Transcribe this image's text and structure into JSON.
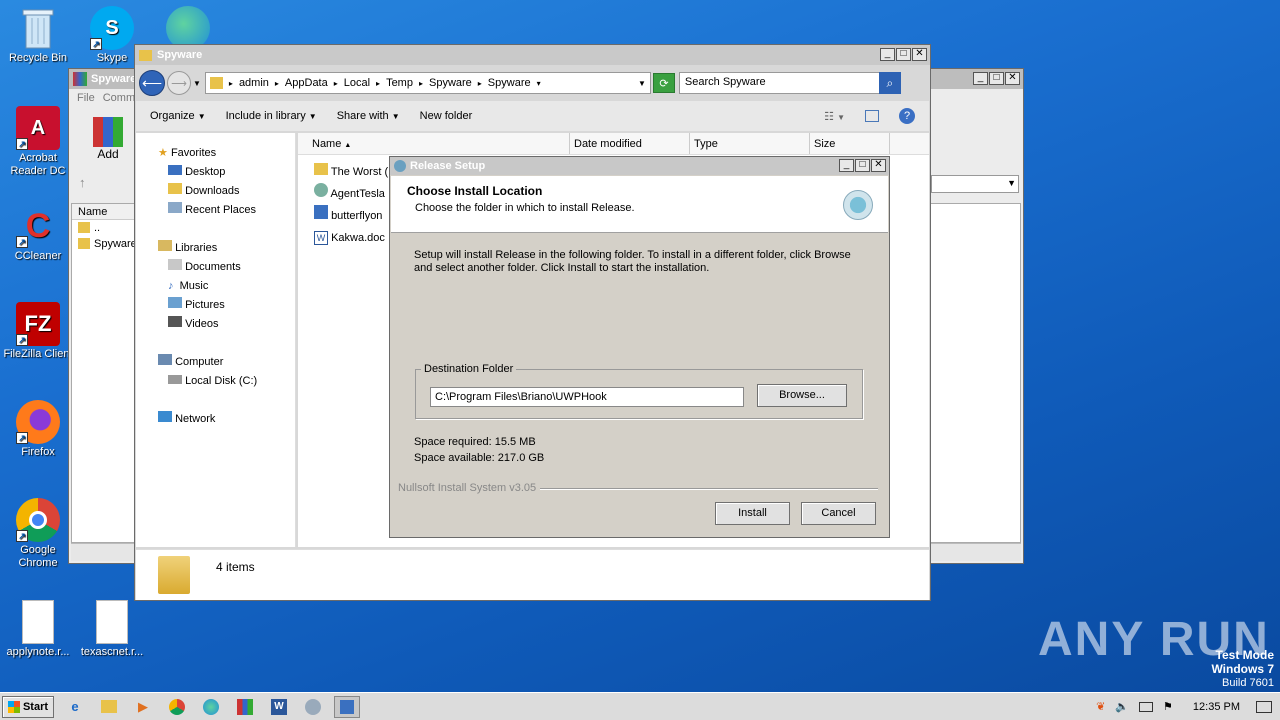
{
  "desktop_icons": [
    {
      "label": "Recycle Bin"
    },
    {
      "label": "Skype"
    },
    {
      "label": "Acrobat Reader DC"
    },
    {
      "label": "CCleaner"
    },
    {
      "label": "FileZilla Client"
    },
    {
      "label": "Firefox"
    },
    {
      "label": "Google Chrome"
    },
    {
      "label": "applynote.r..."
    },
    {
      "label": "texascnet.r..."
    }
  ],
  "back_window": {
    "title": "Spyware",
    "menu_file": "File",
    "menu_comm": "Comm",
    "add_label": "Add",
    "col_name": "Name",
    "rows": [
      "..",
      "Spyware"
    ]
  },
  "explorer": {
    "title": "Spyware",
    "breadcrumb": [
      "admin",
      "AppData",
      "Local",
      "Temp",
      "Spyware",
      "Spyware"
    ],
    "search_placeholder": "Search Spyware",
    "toolbar": {
      "organize": "Organize",
      "include": "Include in library",
      "share": "Share with",
      "new_folder": "New folder"
    },
    "nav": {
      "favorites": "Favorites",
      "desktop": "Desktop",
      "downloads": "Downloads",
      "recent": "Recent Places",
      "libraries": "Libraries",
      "documents": "Documents",
      "music": "Music",
      "pictures": "Pictures",
      "videos": "Videos",
      "computer": "Computer",
      "local_disk": "Local Disk (C:)",
      "network": "Network"
    },
    "columns": {
      "name": "Name",
      "date": "Date modified",
      "type": "Type",
      "size": "Size"
    },
    "files": [
      "The Worst (",
      "AgentTesla",
      "butterflyon",
      "Kakwa.doc"
    ],
    "status": "4 items"
  },
  "setup": {
    "title": "Release Setup",
    "heading": "Choose Install Location",
    "subheading": "Choose the folder in which to install Release.",
    "description": "Setup will install Release in the following folder. To install in a different folder, click Browse and select another folder. Click Install to start the installation.",
    "dest_label": "Destination Folder",
    "dest_value": "C:\\Program Files\\Briano\\UWPHook",
    "browse": "Browse...",
    "space_required": "Space required: 15.5 MB",
    "space_available": "Space available: 217.0 GB",
    "branding": "Nullsoft Install System v3.05",
    "install": "Install",
    "cancel": "Cancel"
  },
  "watermark": {
    "brand": "ANY RUN",
    "line1": "Test Mode",
    "line2": "Windows 7",
    "line3": "Build 7601"
  },
  "taskbar": {
    "start": "Start",
    "time": "12:35 PM"
  }
}
